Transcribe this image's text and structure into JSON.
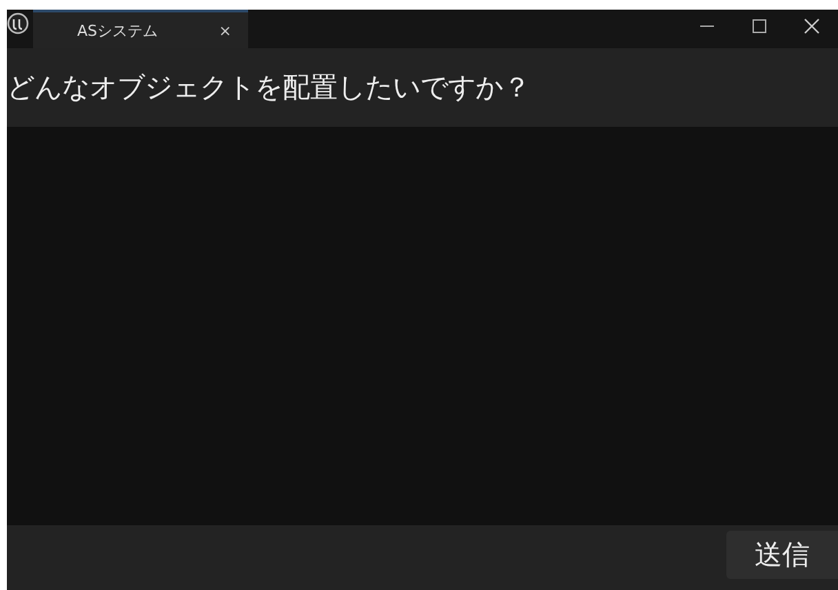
{
  "tabs": [
    {
      "title": "ASシステム",
      "close": "×",
      "selected": true
    }
  ],
  "question": "どんなオブジェクトを配置したいですか？",
  "send_button": "送信"
}
